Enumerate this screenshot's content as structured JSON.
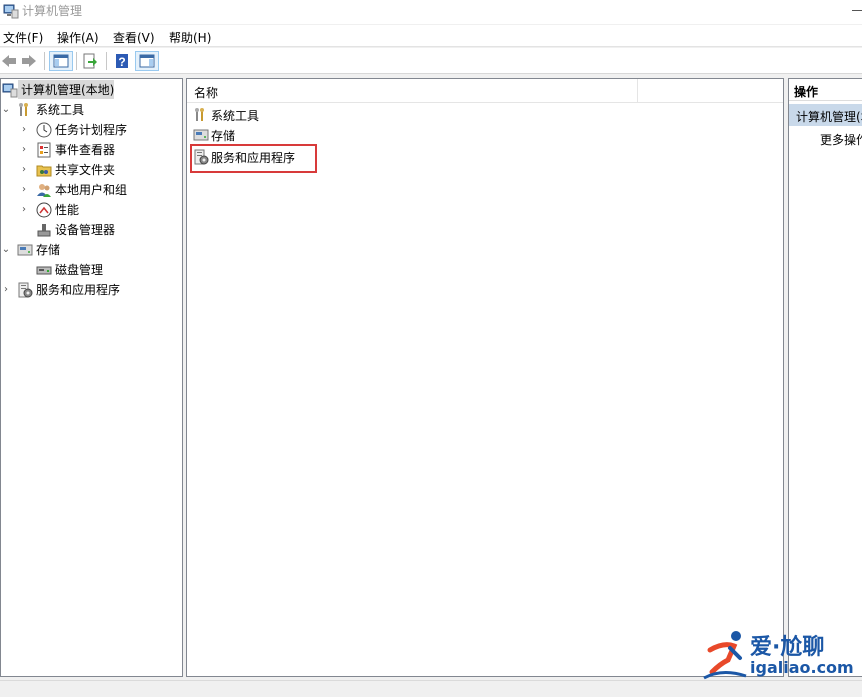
{
  "window": {
    "title": "计算机管理"
  },
  "menu": {
    "items": [
      "文件(F)",
      "操作(A)",
      "查看(V)",
      "帮助(H)"
    ]
  },
  "toolbar": {
    "buttons": [
      "back-icon",
      "forward-icon",
      "show-hide-tree-icon",
      "export-icon",
      "help-icon",
      "action-pane-icon"
    ]
  },
  "tree": {
    "root": "计算机管理(本地)",
    "system_tools": "系统工具",
    "task_scheduler": "任务计划程序",
    "event_viewer": "事件查看器",
    "shared_folders": "共享文件夹",
    "local_users": "本地用户和组",
    "performance": "性能",
    "device_manager": "设备管理器",
    "storage": "存储",
    "disk_management": "磁盘管理",
    "services_apps": "服务和应用程序"
  },
  "list": {
    "column_name": "名称",
    "rows": [
      "系统工具",
      "存储",
      "服务和应用程序"
    ]
  },
  "actions": {
    "header": "操作",
    "selected": "计算机管理(本地)",
    "more": "更多操作"
  },
  "watermark": {
    "title": "爱·尬聊",
    "url": "igaliao.com"
  },
  "colors": {
    "highlight_border": "#d83a3a",
    "selection": "#d9d9d9",
    "action_selected": "#c9d9ea",
    "watermark": "#1b57a6"
  }
}
